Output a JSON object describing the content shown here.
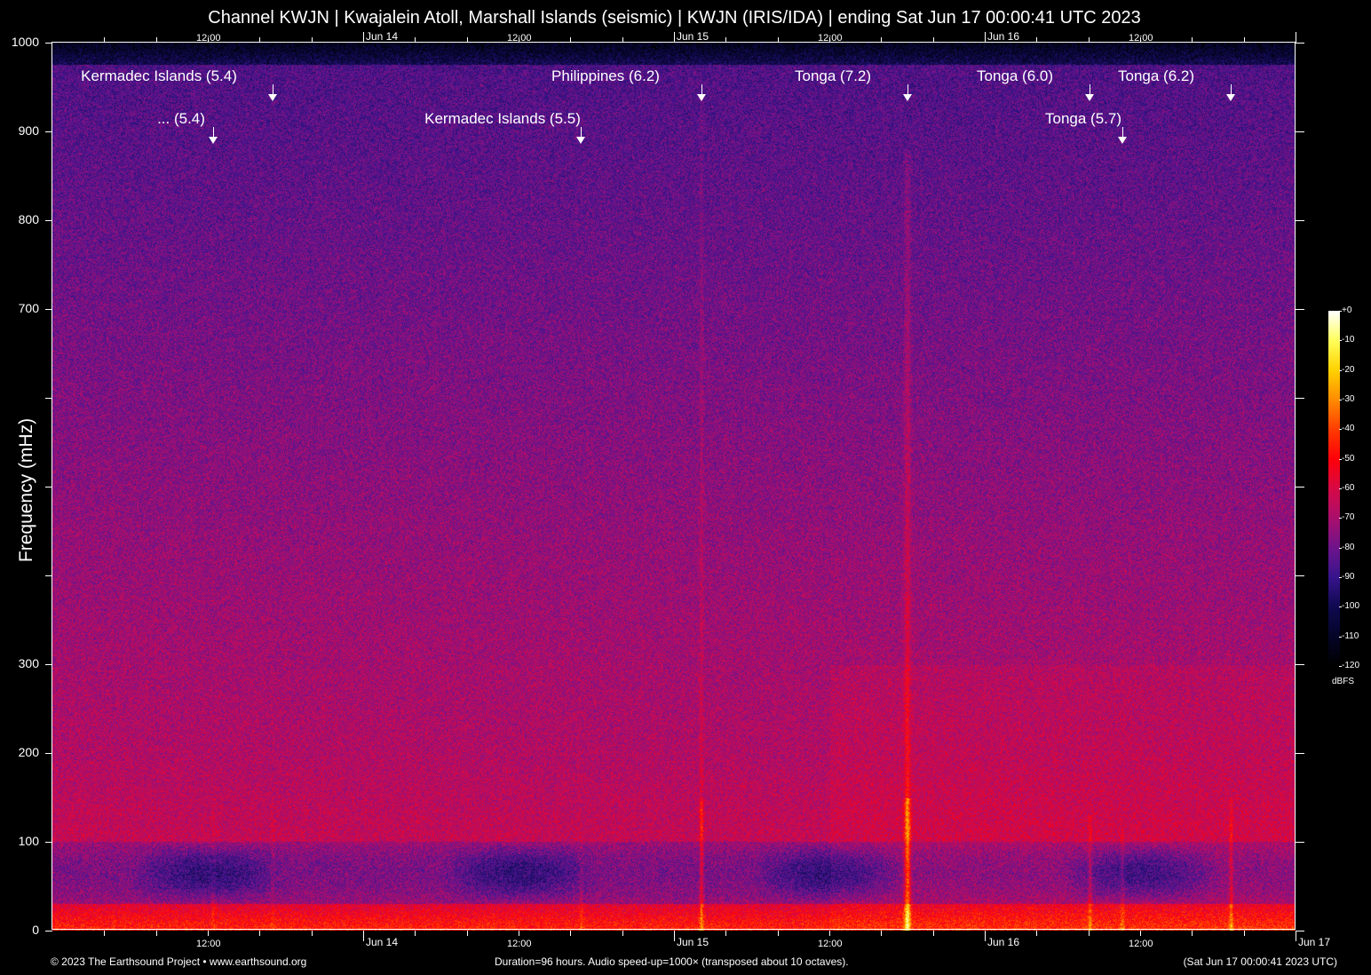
{
  "chart_data": {
    "type": "heatmap",
    "title": "Channel KWJN | Kwajalein Atoll, Marshall Islands (seismic) | KWJN (IRIS/IDA) | ending Sat Jun 17 00:00:41 UTC 2023",
    "ylabel": "Frequency (mHz)",
    "ylim": [
      0,
      1000
    ],
    "xlim_hours": [
      0,
      96
    ],
    "y_ticks": [
      0,
      100,
      200,
      300,
      400,
      500,
      600,
      700,
      800,
      900,
      1000
    ],
    "y_tick_labels": [
      "0",
      "100",
      "200",
      "300",
      "",
      "",
      "",
      "700",
      "800",
      "900",
      "1000"
    ],
    "x_tick_step_hours": 4,
    "x_labels": [
      {
        "hour": 12,
        "label": "12:00",
        "day": false
      },
      {
        "hour": 24,
        "label": "Jun 14",
        "day": true
      },
      {
        "hour": 36,
        "label": "12:00",
        "day": false
      },
      {
        "hour": 48,
        "label": "Jun 15",
        "day": true
      },
      {
        "hour": 60,
        "label": "12:00",
        "day": false
      },
      {
        "hour": 72,
        "label": "Jun 16",
        "day": true
      },
      {
        "hour": 84,
        "label": "12:00",
        "day": false
      }
    ],
    "x_end_label": "Jun 17",
    "colorbar": {
      "unit": "dBFS",
      "range": [
        -120,
        0
      ],
      "tick_labels": [
        "+0",
        "-10",
        "-20",
        "-30",
        "-40",
        "-50",
        "-60",
        "-70",
        "-80",
        "-90",
        "-100",
        "-110",
        "-120"
      ]
    },
    "events": [
      {
        "label": "Kermadec Islands (5.4)",
        "hour": 17.0,
        "row": 0,
        "magnitude": 5.4,
        "max_freq": 150
      },
      {
        "label": "... (5.4)",
        "hour": 12.4,
        "row": 1,
        "magnitude": 5.4,
        "max_freq": 160
      },
      {
        "label": "Kermadec Islands (5.5)",
        "hour": 40.8,
        "row": 1,
        "magnitude": 5.5,
        "max_freq": 110
      },
      {
        "label": "Philippines (6.2)",
        "hour": 50.1,
        "row": 0,
        "magnitude": 6.2,
        "max_freq": 940
      },
      {
        "label": "Tonga (7.2)",
        "hour": 66.0,
        "row": 0,
        "magnitude": 7.2,
        "max_freq": 880
      },
      {
        "label": "Tonga (6.0)",
        "hour": 80.1,
        "row": 0,
        "magnitude": 6.0,
        "max_freq": 130
      },
      {
        "label": "Tonga (5.7)",
        "hour": 82.6,
        "row": 1,
        "magnitude": 5.7,
        "max_freq": 110
      },
      {
        "label": "Tonga (6.2)",
        "hour": 91.0,
        "row": 0,
        "magnitude": 6.2,
        "max_freq": 150
      }
    ]
  },
  "footer": {
    "copyright": "© 2023 The Earthsound Project • www.earthsound.org",
    "info": "Duration=96 hours. Audio speed-up=1000× (transposed about 10 octaves).",
    "timestamp": "(Sat Jun 17 00:00:41 2023 UTC)"
  },
  "colors": {
    "background": "#000000",
    "text": "#ffffff"
  }
}
